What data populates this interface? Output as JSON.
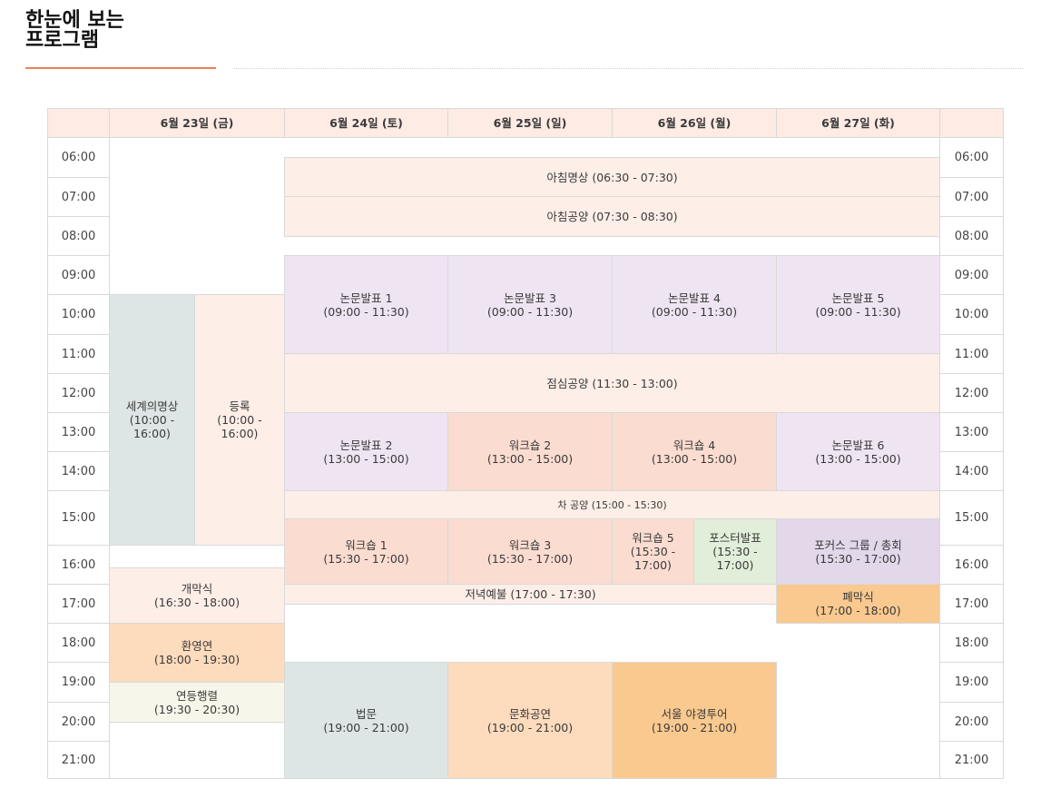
{
  "page": {
    "title_line1": "한눈에 보는",
    "title_line2": "프로그램"
  },
  "colors": {
    "header": "#fdebe4",
    "light_pink": "#fdeee8",
    "lavender": "#efe4f2",
    "salmon": "#fbdcd0",
    "grey": "#dde6e4",
    "peach": "#fddbbd",
    "orange": "#f9c98f",
    "green": "#e1eed9",
    "purple": "#e3d7ea",
    "cream": "#f6f6ea"
  },
  "table": {
    "days": [
      "6월 23일 (금)",
      "6월 24일 (토)",
      "6월 25일 (일)",
      "6월 26일 (월)",
      "6월 27일 (화)"
    ],
    "times": [
      "06:00",
      "07:00",
      "08:00",
      "09:00",
      "10:00",
      "11:00",
      "12:00",
      "13:00",
      "14:00",
      "15:00",
      "16:00",
      "17:00",
      "18:00",
      "19:00",
      "20:00",
      "21:00"
    ],
    "events": {
      "morning_meditation": "아침명상 (06:30 - 07:30)",
      "morning_offering": "아침공양 (07:30 - 08:30)",
      "paper1": "논문발표 1\n(09:00 - 11:30)",
      "paper3": "논문발표 3\n(09:00 - 11:30)",
      "paper4": "논문발표 4\n(09:00 - 11:30)",
      "paper5": "논문발표 5\n(09:00 - 11:30)",
      "world_meditation": "세계의명상\n(10:00 -\n16:00)",
      "registration": "등록\n(10:00 -\n16:00)",
      "lunch": "점심공양 (11:30 - 13:00)",
      "paper2": "논문발표 2\n(13:00 - 15:00)",
      "workshop2": "워크숍 2\n(13:00 - 15:00)",
      "workshop4": "워크숍 4\n(13:00 - 15:00)",
      "paper6": "논문발표 6\n(13:00 - 15:00)",
      "tea": "차 공양 (15:00 - 15:30)",
      "workshop1": "워크숍 1\n(15:30 - 17:00)",
      "workshop3": "워크숍 3\n(15:30 - 17:00)",
      "workshop5": "워크숍 5\n(15:30 -\n17:00)",
      "poster": "포스터발표\n(15:30 -\n17:00)",
      "focus": "포커스 그룹 / 총회\n(15:30 - 17:00)",
      "opening": "개막식\n(16:30 - 18:00)",
      "evening_service": "저녁예불 (17:00 - 17:30)",
      "closing": "폐막식\n(17:00 - 18:00)",
      "welcome": "환영연\n(18:00 - 19:30)",
      "lantern": "연등행렬\n(19:30 - 20:30)",
      "dharma": "법문\n(19:00 - 21:00)",
      "culture": "문화공연\n(19:00 - 21:00)",
      "night_tour": "서울 야경투어\n(19:00 - 21:00)"
    }
  }
}
